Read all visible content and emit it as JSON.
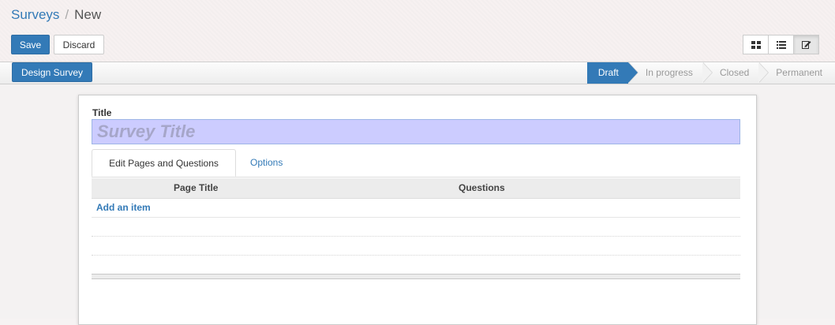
{
  "breadcrumb": {
    "parent": "Surveys",
    "separator": "/",
    "current": "New"
  },
  "actions": {
    "save_label": "Save",
    "discard_label": "Discard"
  },
  "view_switcher": [
    {
      "name": "kanban-view-icon",
      "active": false
    },
    {
      "name": "list-view-icon",
      "active": false
    },
    {
      "name": "form-view-icon",
      "active": true
    }
  ],
  "statusbar": {
    "design_button": "Design Survey",
    "stages": [
      {
        "label": "Draft",
        "active": true
      },
      {
        "label": "In progress",
        "active": false
      },
      {
        "label": "Closed",
        "active": false
      },
      {
        "label": "Permanent",
        "active": false
      }
    ]
  },
  "form": {
    "title_label": "Title",
    "title_placeholder": "Survey Title",
    "title_value": "",
    "tabs": [
      {
        "label": "Edit Pages and Questions",
        "active": true
      },
      {
        "label": "Options",
        "active": false
      }
    ],
    "grid": {
      "columns": [
        "Page Title",
        "Questions"
      ],
      "add_item": "Add an item"
    }
  },
  "colors": {
    "accent": "#337ab7",
    "title_field_bg": "#ccccff"
  }
}
